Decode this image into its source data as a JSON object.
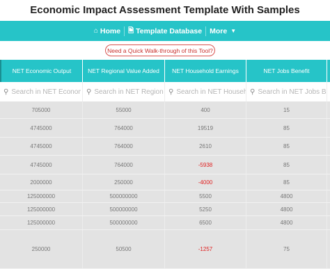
{
  "title": "Economic Impact Assessment Template With Samples",
  "nav": {
    "home_label": "Home",
    "db_label": "Template Database",
    "more_label": "More"
  },
  "walkthrough_label": "Need a Quick Walk-through of this Tool?",
  "table": {
    "columns": [
      "NET Economic Output",
      "NET Regional Value Added",
      "NET Household Earnings",
      "NET Jobs Benefit"
    ],
    "search_placeholders": [
      "Search in NET Economic Output",
      "Search in NET Regional Value Added",
      "Search in NET Household Earnings",
      "Search in NET Jobs Benefit"
    ],
    "rows": [
      [
        "705000",
        "55000",
        "400",
        "15"
      ],
      [
        "4745000",
        "764000",
        "19519",
        "85"
      ],
      [
        "4745000",
        "764000",
        "2610",
        "85"
      ],
      [
        "4745000",
        "764000",
        "-5938",
        "85"
      ],
      [
        "2000000",
        "250000",
        "-4000",
        "85"
      ],
      [
        "125000000",
        "500000000",
        "5500",
        "4800"
      ],
      [
        "125000000",
        "500000000",
        "5250",
        "4800"
      ],
      [
        "125000000",
        "500000000",
        "6500",
        "4800"
      ],
      [
        "250000",
        "50500",
        "-1257",
        "75"
      ]
    ]
  },
  "colors": {
    "accent": "#26c4c8",
    "negative": "#e02020",
    "outline_button": "#d9534f"
  }
}
